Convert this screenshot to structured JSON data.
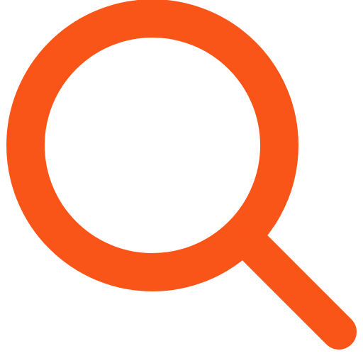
{
  "icon": {
    "name": "search-icon",
    "color": "#FA5519",
    "background": "#FFFFFF"
  }
}
